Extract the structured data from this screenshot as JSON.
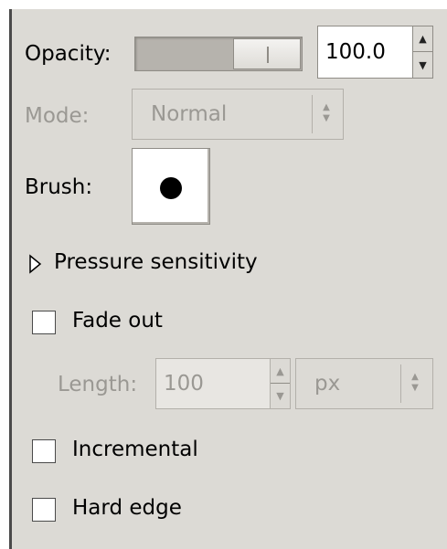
{
  "opacity": {
    "label": "Opacity:",
    "value_text": "100.0",
    "slider_fraction": 1.0,
    "up_icon": "spin-up-icon",
    "down_icon": "spin-down-icon"
  },
  "mode": {
    "label": "Mode:",
    "selected": "Normal",
    "enabled": false
  },
  "brush": {
    "label": "Brush:",
    "preview_icon": "round-brush-icon"
  },
  "pressure": {
    "label": "Pressure sensitivity",
    "expanded": false
  },
  "fade_out": {
    "label": "Fade out",
    "checked": false,
    "length_label": "Length:",
    "length_value": "100",
    "unit": "px"
  },
  "incremental": {
    "label": "Incremental",
    "checked": false
  },
  "hard_edge": {
    "label": "Hard edge",
    "checked": false
  },
  "colors": {
    "panel_bg": "#dcdad5",
    "disabled_text": "#9a9893",
    "border_dark": "#4a4a4a"
  }
}
